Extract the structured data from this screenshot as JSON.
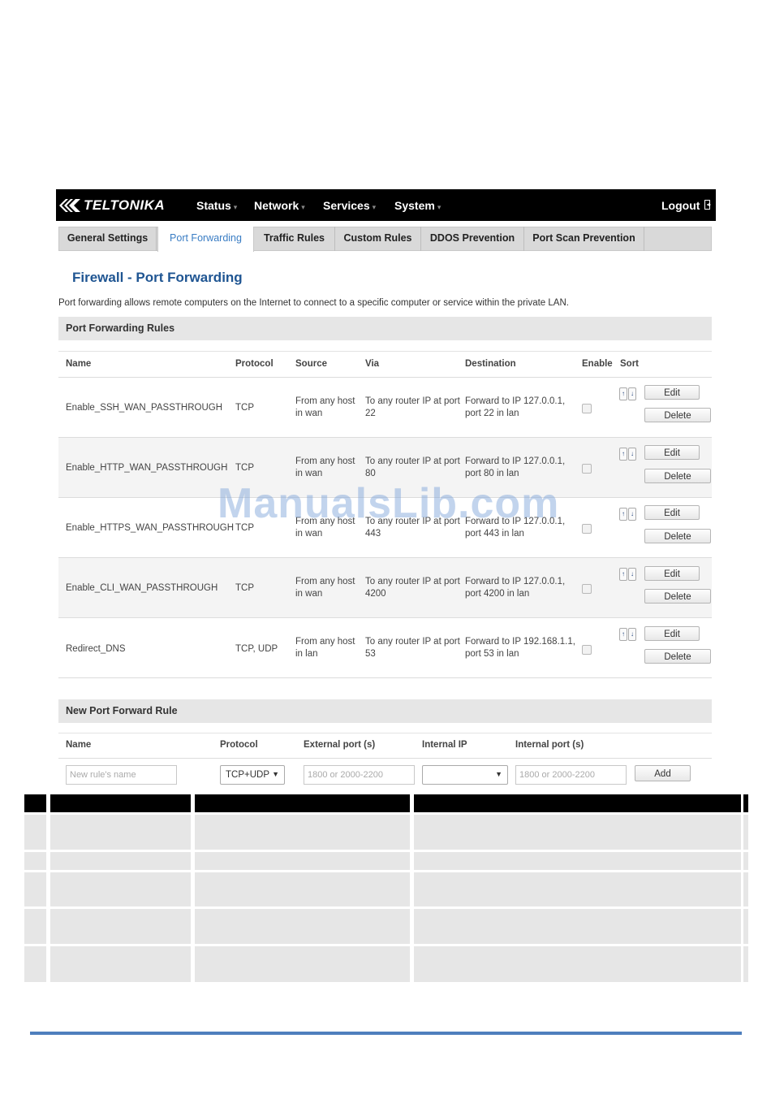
{
  "brand": {
    "logo_text": "TELTONIKA"
  },
  "nav": {
    "items": [
      {
        "label": "Status",
        "caret": "▾"
      },
      {
        "label": "Network",
        "caret": "▾"
      },
      {
        "label": "Services",
        "caret": "▾"
      },
      {
        "label": "System",
        "caret": "▾"
      }
    ],
    "logout": "Logout",
    "logout_icon": "logout-icon"
  },
  "tabs": [
    {
      "label": "General Settings"
    },
    {
      "label": "Port Forwarding",
      "active": true
    },
    {
      "label": "Traffic Rules"
    },
    {
      "label": "Custom Rules"
    },
    {
      "label": "DDOS Prevention"
    },
    {
      "label": "Port Scan Prevention"
    }
  ],
  "page": {
    "title": "Firewall - Port Forwarding",
    "description": "Port forwarding allows remote computers on the Internet to connect to a specific computer or service within the private LAN."
  },
  "rules": {
    "section_title": "Port Forwarding Rules",
    "headers": {
      "name": "Name",
      "protocol": "Protocol",
      "source": "Source",
      "via": "Via",
      "destination": "Destination",
      "enable": "Enable",
      "sort": "Sort"
    },
    "edit_label": "Edit",
    "delete_label": "Delete",
    "sort_up": "↑",
    "sort_down": "↓",
    "rows": [
      {
        "name": "Enable_SSH_WAN_PASSTHROUGH",
        "protocol": "TCP",
        "source1": "From any host",
        "source2": "in wan",
        "via1": "To any router IP at port",
        "via2": "22",
        "dest1": "Forward to IP 127.0.0.1,",
        "dest2": "port 22 in lan",
        "enabled": false
      },
      {
        "name": "Enable_HTTP_WAN_PASSTHROUGH",
        "protocol": "TCP",
        "source1": "From any host",
        "source2": "in wan",
        "via1": "To any router IP at port",
        "via2": "80",
        "dest1": "Forward to IP 127.0.0.1,",
        "dest2": "port 80 in lan",
        "enabled": false
      },
      {
        "name": "Enable_HTTPS_WAN_PASSTHROUGH",
        "protocol": "TCP",
        "source1": "From any host",
        "source2": "in wan",
        "via1": "To any router IP at port",
        "via2": "443",
        "dest1": "Forward to IP 127.0.0.1,",
        "dest2": "port 443 in lan",
        "enabled": false
      },
      {
        "name": "Enable_CLI_WAN_PASSTHROUGH",
        "protocol": "TCP",
        "source1": "From any host",
        "source2": "in wan",
        "via1": "To any router IP at port",
        "via2": "4200",
        "dest1": "Forward to IP 127.0.0.1,",
        "dest2": "port 4200 in lan",
        "enabled": false
      },
      {
        "name": "Redirect_DNS",
        "protocol": "TCP, UDP",
        "source1": "From any host",
        "source2": "in lan",
        "via1": "To any router IP at port",
        "via2": "53",
        "dest1": "Forward to IP 192.168.1.1,",
        "dest2": "port 53 in lan",
        "enabled": false
      }
    ]
  },
  "new_rule": {
    "section_title": "New Port Forward Rule",
    "headers": {
      "name": "Name",
      "protocol": "Protocol",
      "external_port": "External port (s)",
      "internal_ip": "Internal IP",
      "internal_port": "Internal port (s)"
    },
    "name_placeholder": "New rule's name",
    "protocol_value": "TCP+UDP",
    "external_port_placeholder": "1800 or 2000-2200",
    "internal_ip_value": "",
    "internal_port_placeholder": "1800 or 2000-2200",
    "add_label": "Add"
  },
  "watermark": "ManualsLib.com"
}
